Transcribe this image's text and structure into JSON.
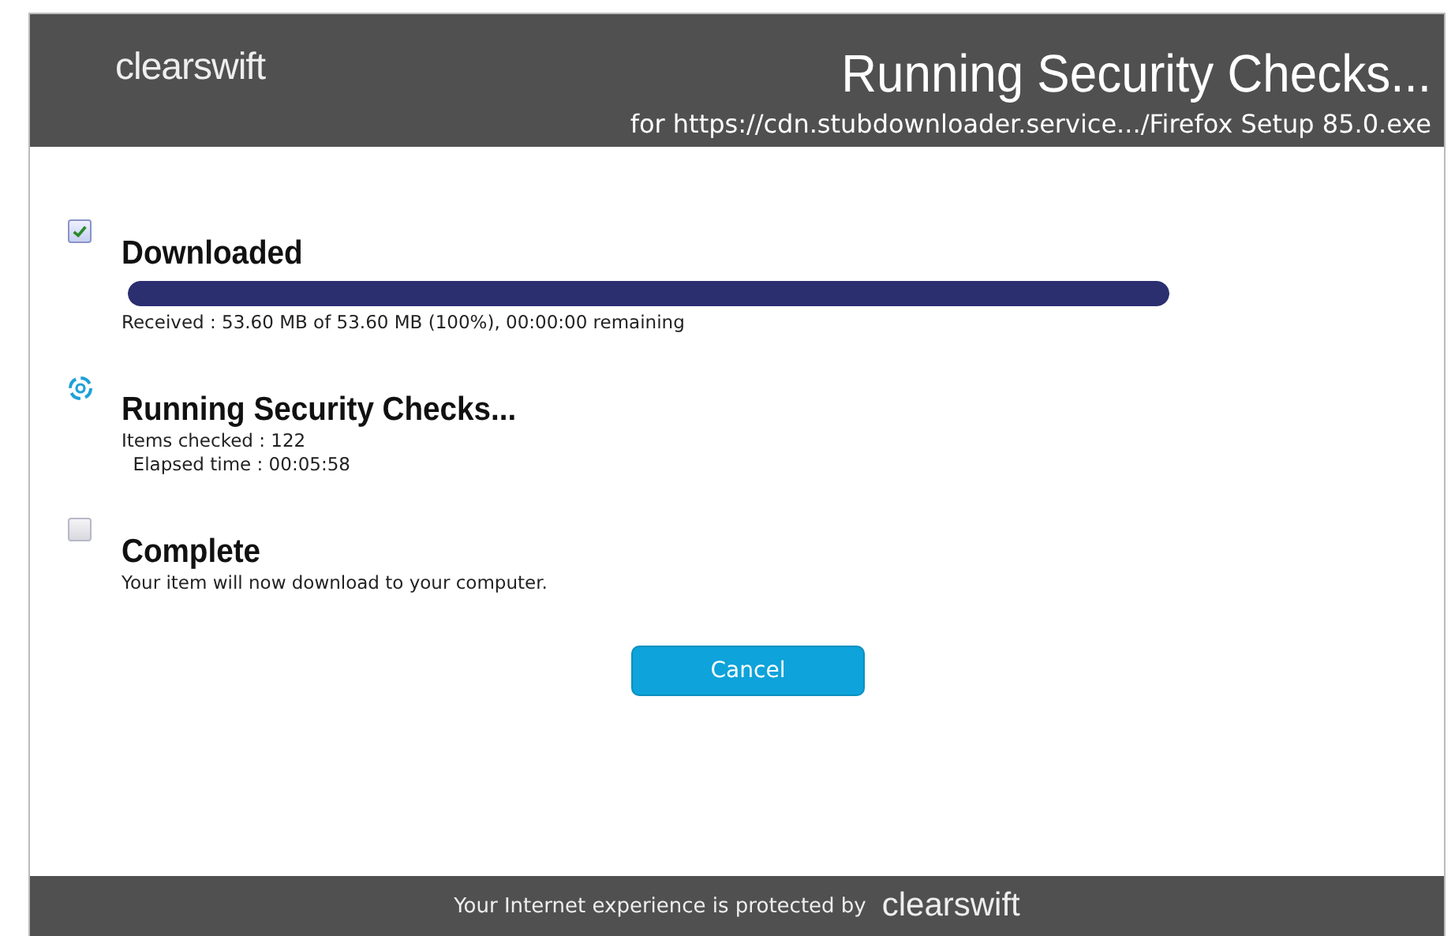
{
  "header": {
    "logo": "clearswift",
    "title": "Running Security Checks...",
    "subtitle": "for https://cdn.stubdownloader.service.../Firefox Setup 85.0.exe"
  },
  "steps": [
    {
      "kind": "checkbox",
      "checked": true,
      "title": "Downloaded",
      "progress": {
        "level": 1
      },
      "lines": [
        "Received : 53.60 MB of 53.60 MB (100%), 00:00:00 remaining"
      ]
    },
    {
      "kind": "spinner",
      "title": "Running Security Checks...",
      "lines": [
        "Items checked : 122",
        "  Elapsed time : 00:05:58"
      ]
    },
    {
      "kind": "checkbox",
      "checked": false,
      "title": "Complete",
      "lines": [
        "Your item will now download to your computer."
      ]
    }
  ],
  "cancel_button": "Cancel",
  "footer": {
    "text": "Your Internet experience is protected by",
    "logo": "clearswift"
  }
}
